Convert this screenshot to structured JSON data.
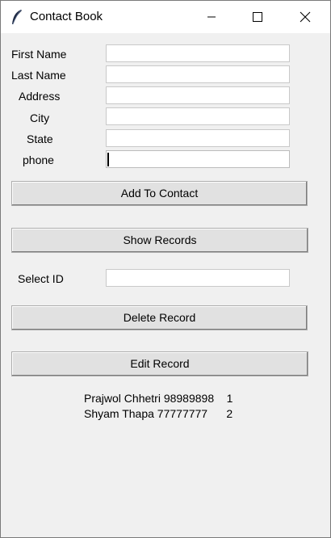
{
  "window": {
    "title": "Contact Book",
    "controls": [
      "minimize-icon",
      "maximize-icon",
      "close-icon"
    ]
  },
  "form": {
    "fields": [
      {
        "label": "First Name",
        "value": ""
      },
      {
        "label": "Last Name",
        "value": ""
      },
      {
        "label": "Address",
        "value": ""
      },
      {
        "label": "City",
        "value": ""
      },
      {
        "label": "State",
        "value": ""
      },
      {
        "label": "phone",
        "value": ""
      }
    ],
    "add_button": "Add To Contact",
    "show_button": "Show Records",
    "select_id_label": "Select ID",
    "select_id_value": "",
    "delete_button": "Delete Record",
    "edit_button": "Edit Record"
  },
  "records": [
    "Prajwol Chhetri 98989898    1",
    "Shyam Thapa 77777777      2"
  ]
}
